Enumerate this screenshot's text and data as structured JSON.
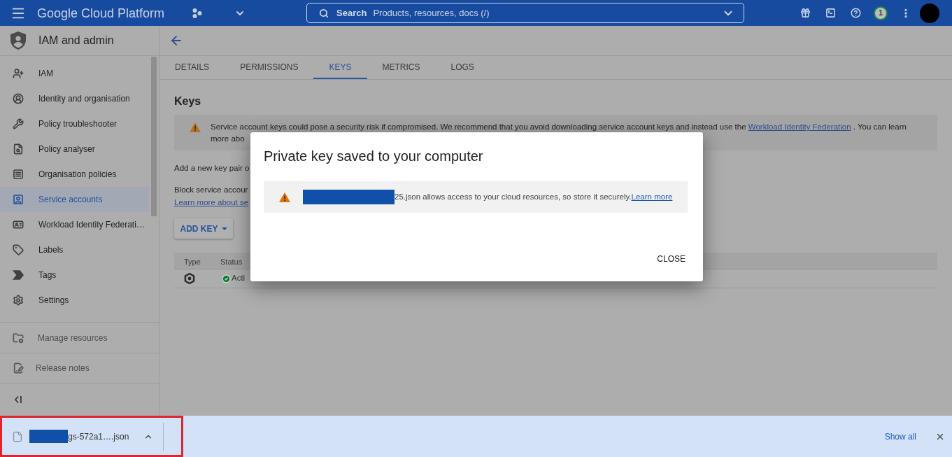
{
  "top_bar": {
    "title": "Google Cloud Platform",
    "search": {
      "label": "Search",
      "placeholder": "Products, resources, docs (/)"
    },
    "notifications": "1"
  },
  "sidebar": {
    "title": "IAM and admin",
    "items": [
      {
        "label": "IAM",
        "selected": false
      },
      {
        "label": "Identity and organisation",
        "selected": false
      },
      {
        "label": "Policy troubleshooter",
        "selected": false
      },
      {
        "label": "Policy analyser",
        "selected": false
      },
      {
        "label": "Organisation policies",
        "selected": false
      },
      {
        "label": "Service accounts",
        "selected": true
      },
      {
        "label": "Workload Identity Federati…",
        "selected": false
      },
      {
        "label": "Labels",
        "selected": false
      },
      {
        "label": "Tags",
        "selected": false
      },
      {
        "label": "Settings",
        "selected": false
      }
    ],
    "footer": [
      {
        "label": "Manage resources"
      },
      {
        "label": "Release notes"
      }
    ]
  },
  "page": {
    "tabs": [
      {
        "label": "DETAILS",
        "selected": false
      },
      {
        "label": "PERMISSIONS",
        "selected": false
      },
      {
        "label": "KEYS",
        "selected": true
      },
      {
        "label": "METRICS",
        "selected": false
      },
      {
        "label": "LOGS",
        "selected": false
      }
    ],
    "heading": "Keys",
    "warning": {
      "text": "Service account keys could pose a security risk if compromised. We recommend that you avoid downloading service account keys and instead use the ",
      "link": "Workload Identity Federation",
      "text_after": " . You can learn",
      "continuation": "more abo"
    },
    "add_key_text": "Add a new key pair o",
    "block_text": "Block service accour",
    "block_link": "Learn more about se",
    "add_key_button": "ADD KEY",
    "table": {
      "columns": [
        "Type",
        "Status"
      ],
      "rows": [
        {
          "status": "Acti"
        }
      ]
    }
  },
  "dialog": {
    "title": "Private key saved to your computer",
    "notice": {
      "text": "25.json allows access to your cloud resources, so store it securely.",
      "link": "Learn more"
    },
    "close": "CLOSE"
  },
  "download_bar": {
    "file_name": "gs-572a1….json",
    "show_all": "Show all"
  }
}
